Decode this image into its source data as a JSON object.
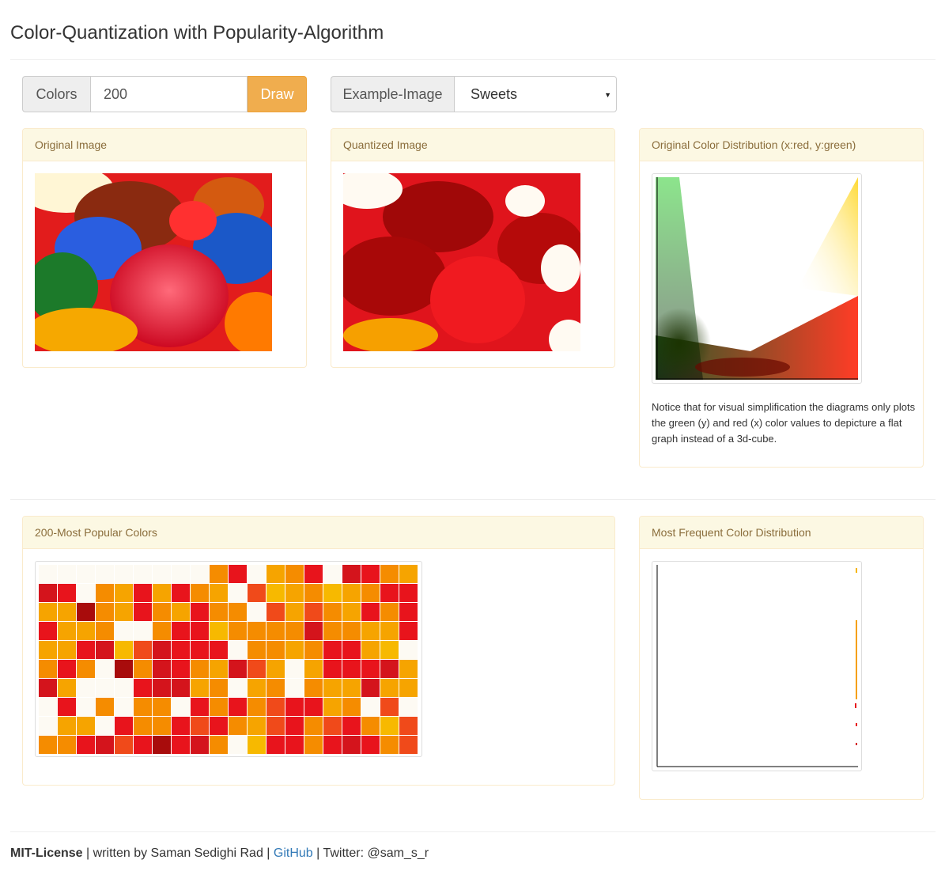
{
  "page": {
    "title": "Color-Quantization with Popularity-Algorithm"
  },
  "controls": {
    "colors_label": "Colors",
    "colors_value": "200",
    "draw_label": "Draw",
    "example_label": "Example-Image",
    "example_selected": "Sweets"
  },
  "panels": {
    "original": {
      "heading": "Original Image"
    },
    "quantized": {
      "heading": "Quantized Image"
    },
    "distribution": {
      "heading": "Original Color Distribution (x:red, y:green)",
      "note": "Notice that for visual simplification the diagrams only plots the green (y) and red (x) color values to depicture a flat graph instead of a 3d-cube."
    },
    "popular": {
      "heading": "200-Most Popular Colors"
    },
    "frequent": {
      "heading": "Most Frequent Color Distribution"
    }
  },
  "palette": {
    "columns": 20,
    "total": 200,
    "hues": [
      "#fdfaf3",
      "#f6a400",
      "#f58c00",
      "#e8141c",
      "#d4141c",
      "#f04a1a",
      "#f7b900",
      "#a80c0c",
      "#f8ef10"
    ]
  },
  "footer": {
    "license": "MIT-License",
    "written_by": " | written by Saman Sedighi Rad | ",
    "github": "GitHub",
    "twitter": " | Twitter: @sam_s_r"
  }
}
